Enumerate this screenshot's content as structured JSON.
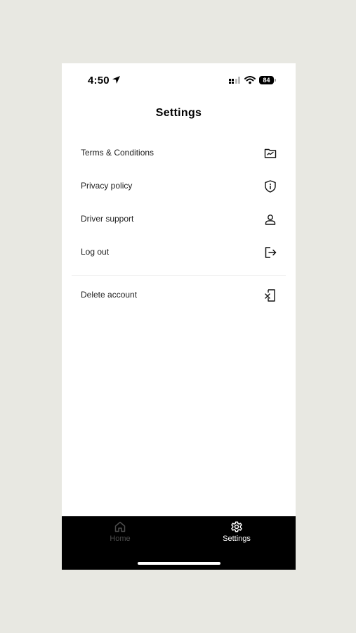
{
  "status_bar": {
    "time": "4:50",
    "battery": "84"
  },
  "page": {
    "title": "Settings"
  },
  "menu": {
    "items": [
      {
        "label": "Terms & Conditions",
        "icon": "document-check-icon"
      },
      {
        "label": "Privacy policy",
        "icon": "shield-info-icon"
      },
      {
        "label": "Driver support",
        "icon": "person-icon"
      },
      {
        "label": "Log out",
        "icon": "logout-icon"
      },
      {
        "label": "Delete account",
        "icon": "delete-device-icon"
      }
    ]
  },
  "tabbar": {
    "tabs": [
      {
        "label": "Home",
        "icon": "home-icon",
        "active": false
      },
      {
        "label": "Settings",
        "icon": "gear-icon",
        "active": true
      }
    ]
  },
  "colors": {
    "background": "#e8e8e2",
    "screen": "#ffffff",
    "tabbar": "#000000",
    "tab_inactive": "#4d4d4d",
    "tab_active": "#ffffff"
  }
}
